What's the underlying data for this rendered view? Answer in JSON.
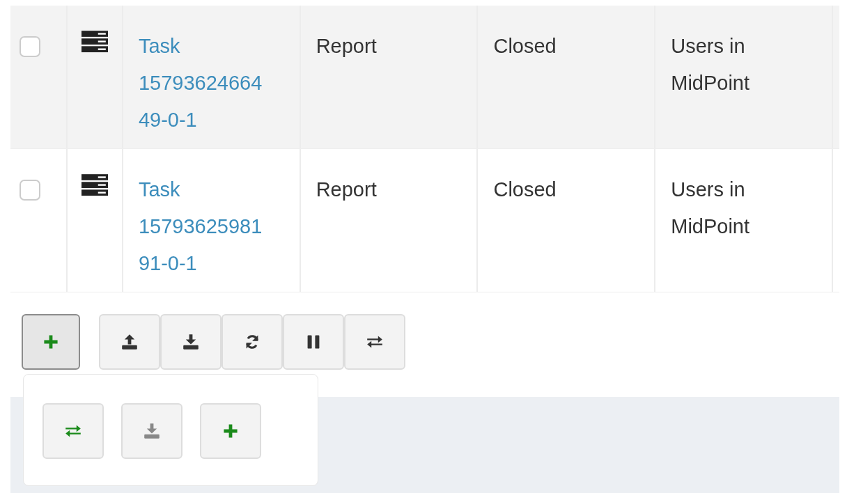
{
  "table": {
    "rows": [
      {
        "checked": false,
        "name": "Task 1579362466449-0-1",
        "type": "Report",
        "status": "Closed",
        "object": "Users in MidPoint"
      },
      {
        "checked": false,
        "name": "Task 1579362598191-0-1",
        "type": "Report",
        "status": "Closed",
        "object": "Users in MidPoint"
      }
    ]
  },
  "toolbar": {
    "add_button": {
      "kind": "plus",
      "color": "#1a8a1a",
      "expanded": true
    },
    "buttons": [
      {
        "kind": "upload",
        "color": "#333333"
      },
      {
        "kind": "download",
        "color": "#333333"
      },
      {
        "kind": "refresh",
        "color": "#333333"
      },
      {
        "kind": "pause",
        "color": "#333333"
      },
      {
        "kind": "swap",
        "color": "#333333"
      }
    ]
  },
  "dropdown": {
    "buttons": [
      {
        "kind": "swap",
        "color": "#1a8a1a"
      },
      {
        "kind": "download",
        "color": "#888888"
      },
      {
        "kind": "plus",
        "color": "#1a8a1a"
      }
    ]
  }
}
